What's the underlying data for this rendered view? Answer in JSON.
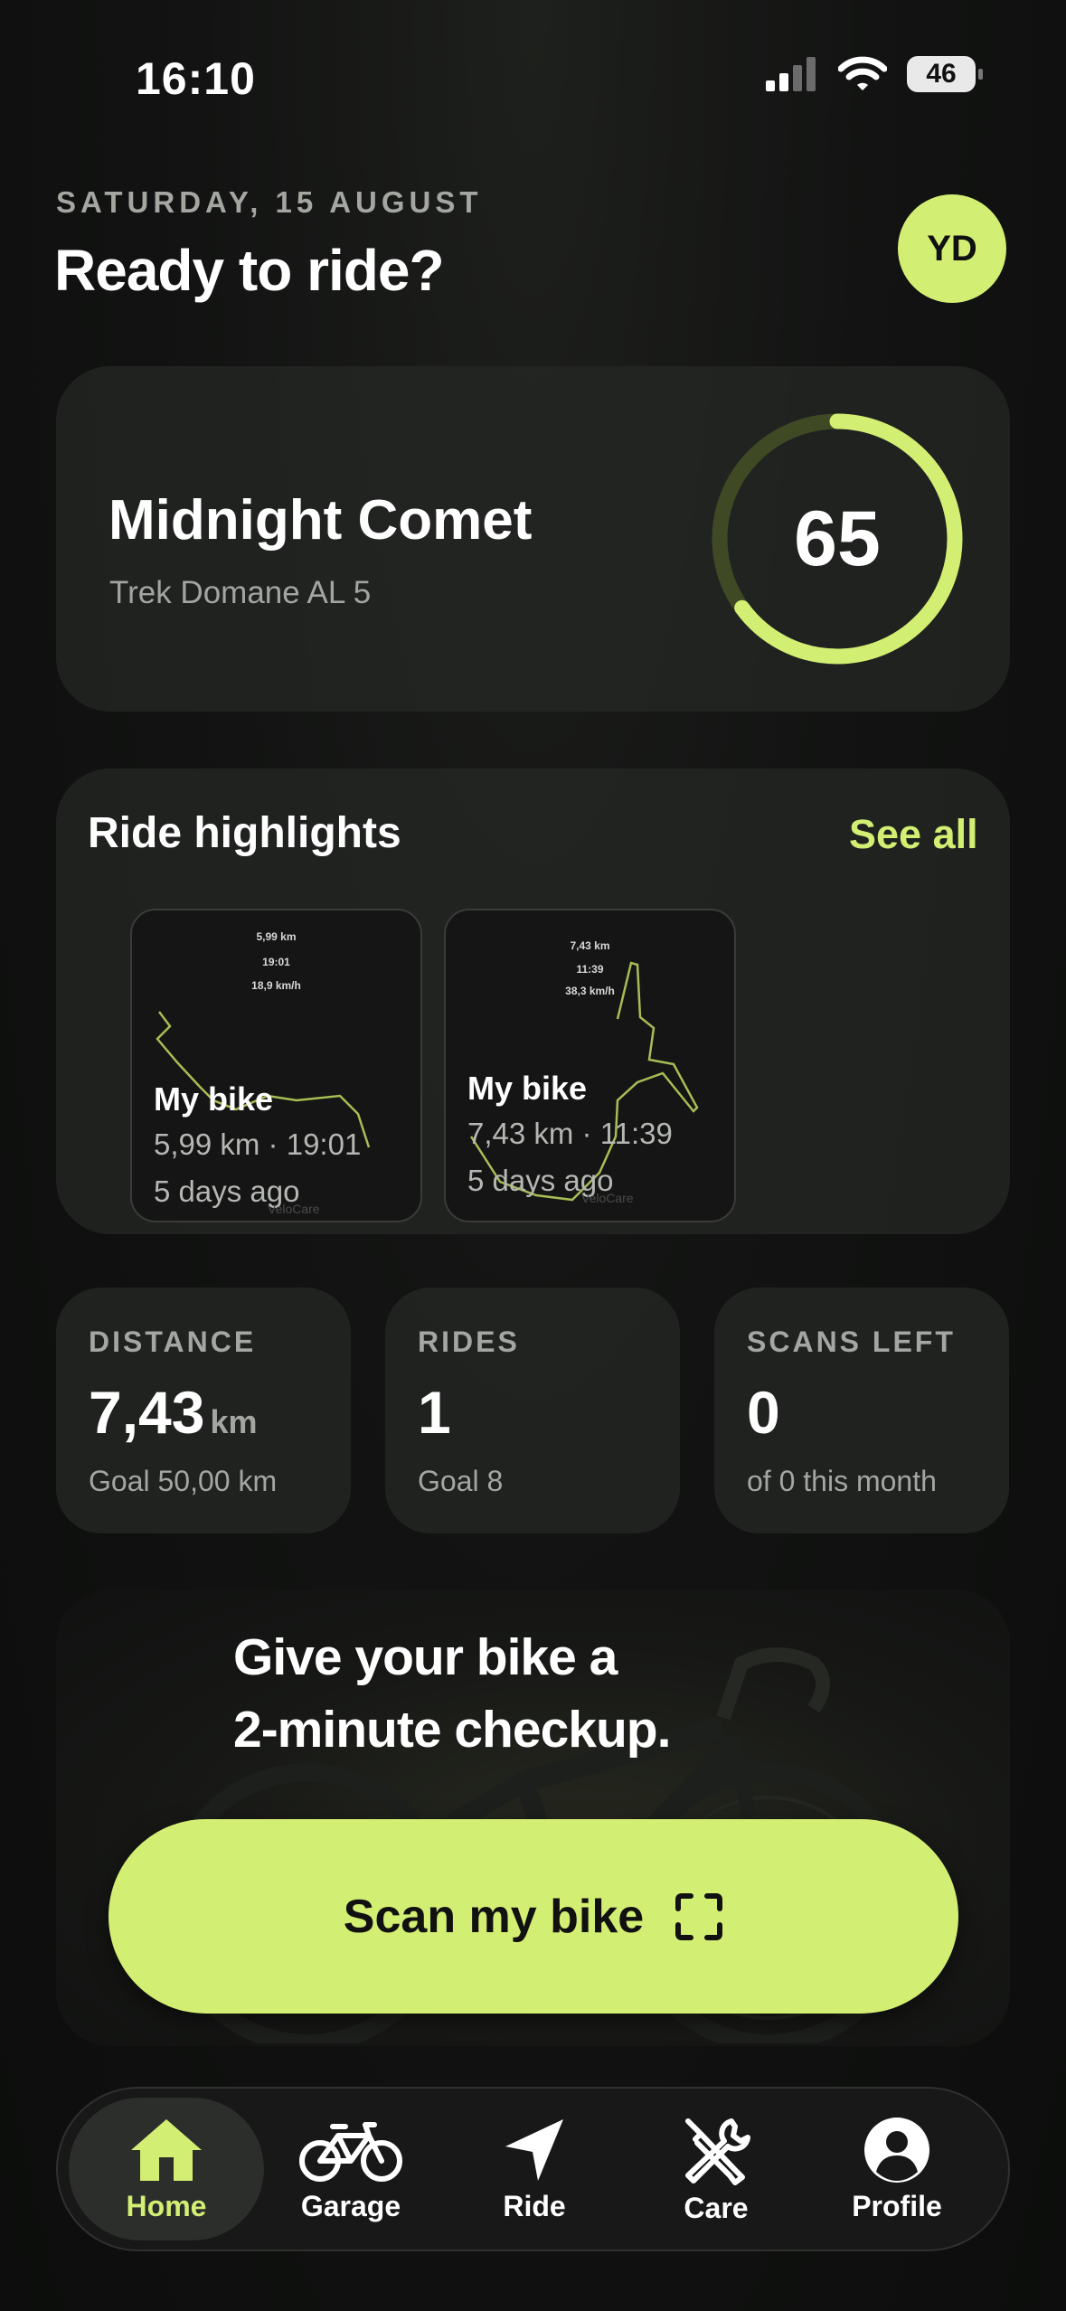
{
  "status_bar": {
    "time": "16:10",
    "battery": "46"
  },
  "header": {
    "date": "SATURDAY, 15 AUGUST",
    "greeting": "Ready to ride?",
    "avatar_initials": "YD"
  },
  "bike": {
    "name": "Midnight Comet",
    "model": "Trek Domane AL 5",
    "score": "65",
    "score_fraction": 0.65
  },
  "highlights": {
    "title": "Ride highlights",
    "see_all": "See all",
    "rides": [
      {
        "thumb_distance": "5,99 km",
        "thumb_time": "19:01",
        "thumb_speed": "18,9 km/h",
        "name": "My bike",
        "stats": "5,99 km · 19:01",
        "ago": "5 days ago",
        "watermark": "VeloCare"
      },
      {
        "thumb_distance": "7,43 km",
        "thumb_time": "11:39",
        "thumb_speed": "38,3 km/h",
        "name": "My bike",
        "stats": "7,43 km · 11:39",
        "ago": "5 days ago",
        "watermark": "VeloCare"
      }
    ]
  },
  "stats": [
    {
      "label": "DISTANCE",
      "value": "7,43",
      "unit": "km",
      "sub": "Goal 50,00 km"
    },
    {
      "label": "RIDES",
      "value": "1",
      "unit": "",
      "sub": "Goal 8"
    },
    {
      "label": "SCANS LEFT",
      "value": "0",
      "unit": "",
      "sub": "of 0 this month"
    }
  ],
  "promo": {
    "line1": "Give your bike a",
    "line2": "2-minute checkup.",
    "button": "Scan my bike"
  },
  "tabs": [
    {
      "label": "Home",
      "icon": "home-icon",
      "active": true
    },
    {
      "label": "Garage",
      "icon": "bicycle-icon",
      "active": false
    },
    {
      "label": "Ride",
      "icon": "navigation-arrow-icon",
      "active": false
    },
    {
      "label": "Care",
      "icon": "tools-icon",
      "active": false
    },
    {
      "label": "Profile",
      "icon": "profile-icon",
      "active": false
    }
  ],
  "colors": {
    "accent": "#d3ef73",
    "background": "#121312",
    "card": "#262825",
    "muted_text": "#a4a6a2"
  }
}
